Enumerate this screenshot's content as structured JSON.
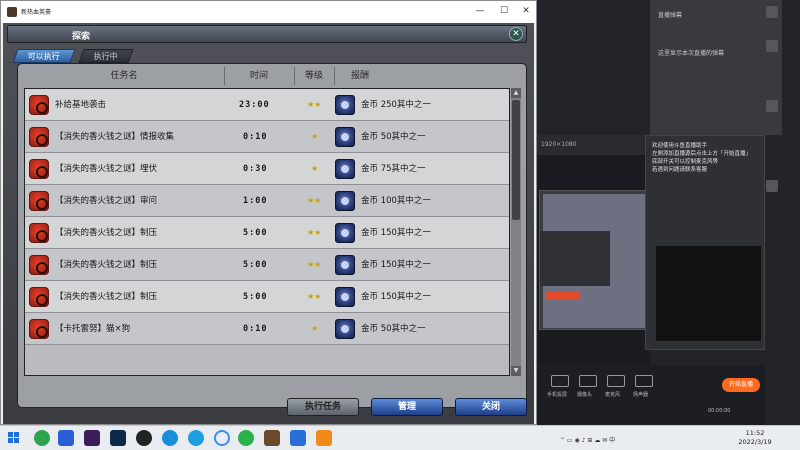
{
  "window": {
    "title": "新热血英豪",
    "minimize": "—",
    "maximize": "☐",
    "close": "✕"
  },
  "dialog": {
    "title": "探索",
    "close": "✕",
    "tabs": [
      {
        "label": "可以执行",
        "active": true
      },
      {
        "label": "执行中",
        "active": false
      }
    ],
    "columns": {
      "name": "任务名",
      "time": "时间",
      "level": "等级",
      "reward": "报酬"
    },
    "tasks": [
      {
        "name": "补给基地袭击",
        "time": "23:00",
        "stars": "★★",
        "reward": "金币  250其中之一"
      },
      {
        "name": "【消失的香火钱之谜】情报收集",
        "time": "0:10",
        "stars": "★",
        "reward": "金币  50其中之一"
      },
      {
        "name": "【消失的香火钱之谜】埋伏",
        "time": "0:30",
        "stars": "★",
        "reward": "金币  75其中之一"
      },
      {
        "name": "【消失的香火钱之谜】审问",
        "time": "1:00",
        "stars": "★★",
        "reward": "金币  100其中之一"
      },
      {
        "name": "【消失的香火钱之谜】制压",
        "time": "5:00",
        "stars": "★★",
        "reward": "金币  150其中之一"
      },
      {
        "name": "【消失的香火钱之谜】制压",
        "time": "5:00",
        "stars": "★★",
        "reward": "金币  150其中之一"
      },
      {
        "name": "【消失的香火钱之谜】制压",
        "time": "5:00",
        "stars": "★★",
        "reward": "金币  150其中之一"
      },
      {
        "name": "【卡托雷努】猫×狗",
        "time": "0:10",
        "stars": "★",
        "reward": "金币  50其中之一"
      }
    ],
    "buttons": {
      "execute": "执行任务",
      "manage": "管理",
      "close": "关闭"
    }
  },
  "stream": {
    "chat_lines": [
      "这里显示本次直播的弹幕"
    ],
    "help_text": [
      "欢迎使用斗鱼直播助手",
      "左侧添加直播源后点击上方「开始直播」",
      "底部开关可以控制麦克风等",
      "若遇到问题请联系客服"
    ],
    "toolbar": [
      "手机投屏",
      "摄像头",
      "麦克风",
      "扬声器"
    ],
    "go_live": "开始直播",
    "timer": "00:00:00"
  },
  "taskbar": {
    "time": "11:52",
    "date": "2022/3/19"
  }
}
